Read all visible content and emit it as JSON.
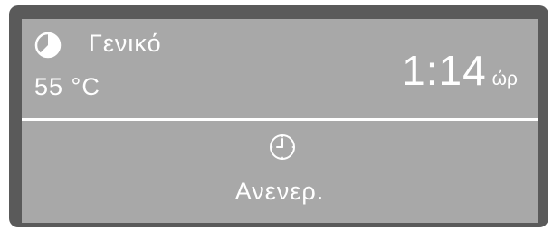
{
  "display": {
    "program_icon": "program-pie-icon",
    "program_name": "Γενικό",
    "temperature": "55 °C",
    "time_value": "1:14",
    "time_unit": "ώρ",
    "delay_icon": "clock-icon",
    "delay_label": "Ανενερ."
  },
  "colors": {
    "bezel": "#5a5a5a",
    "screen": "#a8a8a8",
    "text": "#ffffff"
  }
}
